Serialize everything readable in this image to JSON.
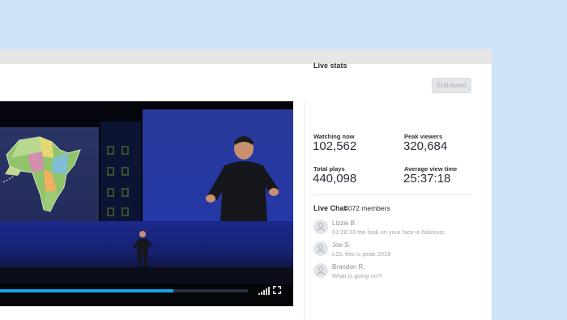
{
  "toolbar": {
    "end_event_label": "End event"
  },
  "video": {
    "progress": 0.7
  },
  "stats": {
    "title": "Live stats",
    "items": [
      {
        "label": "Watching now",
        "value": "102,562"
      },
      {
        "label": "Peak viewers",
        "value": "320,684"
      },
      {
        "label": "Total plays",
        "value": "440,098"
      },
      {
        "label": "Average view time",
        "value": "25:37:18"
      }
    ]
  },
  "chat": {
    "title": "Live Chat",
    "members": "4072 members",
    "messages": [
      {
        "name": "Lizzie B.",
        "text": "01:28:33 the look on your face is hilarious"
      },
      {
        "name": "Joe S.",
        "text": "LOL this is peak 2018"
      },
      {
        "name": "Brandon R.",
        "text": "What is going on?!"
      }
    ]
  },
  "colors": {
    "accent": "#12a5e8",
    "background": "#cfe2fa"
  }
}
